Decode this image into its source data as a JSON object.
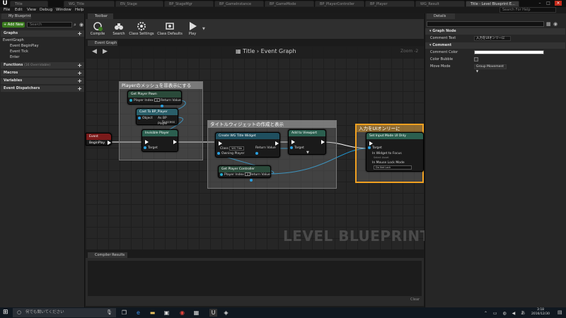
{
  "window": {
    "tabs": [
      "Title",
      "WG_Title",
      "EN_Stage",
      "BP_StageMgr",
      "BP_GameInstance",
      "BP_GameMode",
      "BP_PlayerController",
      "BP_Player",
      "WG_Result",
      "Title - Level Blueprint E..."
    ],
    "active_tab_index": 9
  },
  "menu": [
    "File",
    "Edit",
    "View",
    "Debug",
    "Window",
    "Help"
  ],
  "search_help_placeholder": "Search For Help",
  "left_panel": {
    "tab": "My Blueprint",
    "add_new": "+ Add New",
    "search_placeholder": "Search",
    "graphs_header": "Graphs",
    "tree": [
      "EventGraph",
      "Event BeginPlay",
      "Event Tick",
      "Enter"
    ],
    "functions_header": "Functions",
    "functions_count": "(16 Overridable)",
    "macros_header": "Macros",
    "variables_header": "Variables",
    "dispatchers_header": "Event Dispatchers"
  },
  "toolbar": {
    "tab": "Toolbar",
    "buttons": [
      "Compile",
      "Search",
      "Class Settings",
      "Class Defaults",
      "Play"
    ]
  },
  "graph": {
    "tab": "Event Graph",
    "breadcrumb_root": "Title",
    "breadcrumb_sep": "›",
    "breadcrumb_leaf": "Event Graph",
    "zoom": "Zoom -2",
    "watermark": "LEVEL BLUEPRINT",
    "comment1": "Playerのメッシュを非表示にする",
    "comment2": "タイトルウィジェットの作成と表示",
    "comment3": "入力をUIオンリーに",
    "event_node": "Event BeginPlay",
    "n_get_player_pawn": "Get Player Pawn",
    "n_player_index": "Player Index",
    "n_return_value": "Return Value",
    "n_cast": "Cast To BP_Player",
    "n_object": "Object",
    "n_as_bp_player": "As BP Player",
    "n_success": "Success",
    "n_invisible": "Invisible Player",
    "n_target": "Target",
    "n_create_widget": "Create WG Title Widget",
    "n_class": "Class",
    "n_class_value": "WG Title",
    "n_owning_player": "Owning Player",
    "n_add_viewport": "Add to Viewport",
    "n_get_controller": "Get Player Controller",
    "n_set_input": "Set Input Mode UI Only",
    "n_widget_focus": "In Widget to Focus",
    "n_widget_focus_hint": "Select Asset",
    "n_mouse_lock": "In Mouse Lock Mode",
    "n_mouse_lock_value": "Do Not Lock",
    "index_value": "0"
  },
  "compiler": {
    "tab": "Compiler Results",
    "clear": "Clear"
  },
  "details": {
    "tab": "Details",
    "graph_node_header": "Graph Node",
    "comment_text_label": "Comment Text",
    "comment_text_value": "入力をUIオンリーに",
    "comment_header": "Comment",
    "comment_color_label": "Comment Color",
    "color_bubble_label": "Color Bubble",
    "move_mode_label": "Move Mode",
    "move_mode_value": "Group Movement"
  },
  "taskbar": {
    "search_placeholder": "何でも聞いてください",
    "time": "3:18",
    "date": "2016/12/30"
  },
  "colors": {
    "accent_green": "#3a7a1e",
    "comment_highlight": "#f0a020",
    "wire": "#1fa0e0"
  }
}
